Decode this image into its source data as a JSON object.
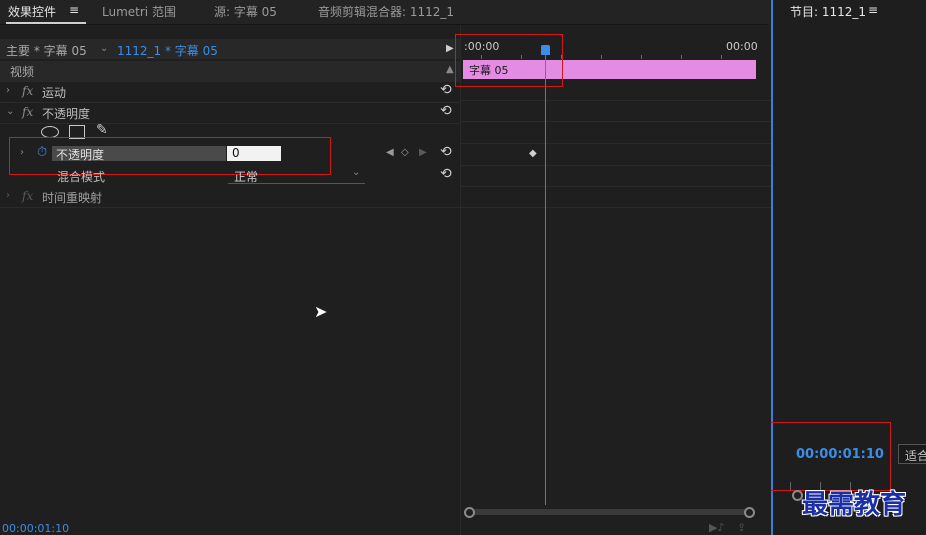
{
  "tabs": [
    {
      "label": "效果控件",
      "menu": "≡"
    },
    {
      "label": "Lumetri 范围"
    },
    {
      "label": "源: 字幕 05"
    },
    {
      "label": "音频剪辑混合器: 1112_1"
    }
  ],
  "program": {
    "tab_label": "节目: 1112_1",
    "menu": "≡",
    "timecode": "00:00:01:10",
    "fit_label": "适合"
  },
  "header": {
    "master": "主要 * 字幕 05",
    "sequence": "1112_1 * 字幕 05"
  },
  "sections": {
    "video": "视频"
  },
  "effects": [
    {
      "fx": "fx",
      "name": "运动"
    },
    {
      "fx": "fx",
      "name": "不透明度"
    },
    {
      "fx": "fx",
      "name": "时间重映射"
    }
  ],
  "opacity": {
    "label": "不透明度",
    "value": "0",
    "blend_label": "混合模式",
    "blend_value": "正常"
  },
  "timeline": {
    "start_time": ":00:00",
    "end_time": "00:00",
    "clip_label": "字幕 05"
  },
  "footer": {
    "timecode": "00:00:01:10"
  },
  "watermark": "最需教育",
  "colors": {
    "accent": "#3b80d6",
    "clip": "#e48ce4",
    "highlight": "#d21a1a"
  }
}
